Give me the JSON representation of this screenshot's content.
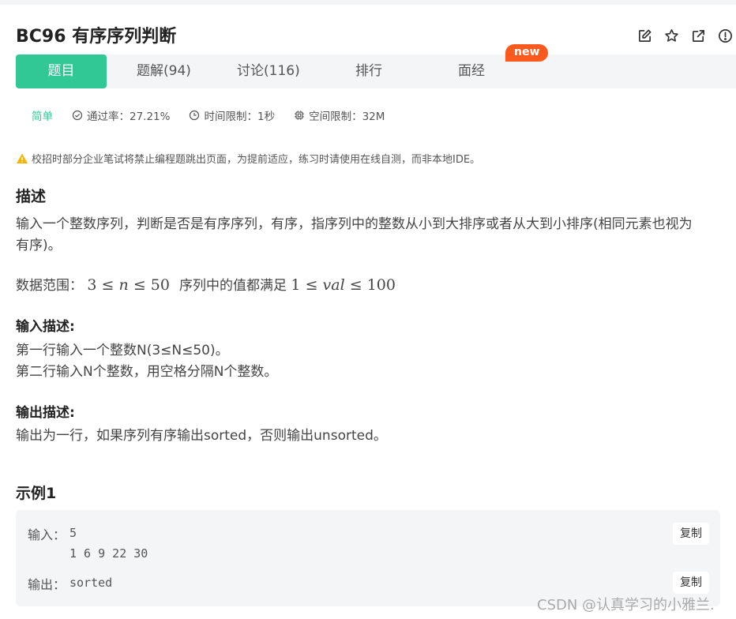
{
  "problem": {
    "title": "BC96  有序序列判断"
  },
  "tabs": [
    {
      "label": "题目"
    },
    {
      "label": "题解(94)"
    },
    {
      "label": "讨论(116)"
    },
    {
      "label": "排行"
    },
    {
      "label": "面经"
    }
  ],
  "badge": "new",
  "header_icons": [
    "edit-icon",
    "star-icon",
    "share-icon",
    "report-icon"
  ],
  "meta": {
    "difficulty": "简单",
    "pass_rate": "通过率：27.21%",
    "time_limit": "时间限制：1秒",
    "memory_limit": "空间限制：32M"
  },
  "notice": "校招时部分企业笔试将禁止编程题跳出页面，为提前适应，练习时请使用在线自测，而非本地IDE。",
  "description": {
    "heading": "描述",
    "line1": "输入一个整数序列，判断是否是有序序列，有序，指序列中的整数从小到大排序或者从大到小排序(相同元素也视为",
    "line2": "有序)。",
    "range_label": "数据范围：",
    "range_mid": "序列中的值都满足",
    "range_n_lower": "3",
    "range_n_var": "n",
    "range_n_upper": "50",
    "range_val_lower": "1",
    "range_val_var": "val",
    "range_val_upper": "100",
    "leq": "≤"
  },
  "input_desc": {
    "heading": "输入描述:",
    "line1": "第一行输入一个整数N(3≤N≤50)。",
    "line2": "第二行输入N个整数，用空格分隔N个整数。"
  },
  "output_desc": {
    "heading": "输出描述:",
    "line1": "输出为一行，如果序列有序输出sorted，否则输出unsorted。"
  },
  "example": {
    "heading": "示例1",
    "input_label": "输入：",
    "input_line1": "5",
    "input_line2": "1 6 9 22 30",
    "output_label": "输出：",
    "output_value": "sorted",
    "copy_label": "复制"
  },
  "watermark": "CSDN @认真学习的小雅兰.",
  "colors": {
    "accent": "#32c895",
    "badge": "#fa5a1e",
    "panel": "#f4f5f7",
    "warning": "#f5b400"
  }
}
